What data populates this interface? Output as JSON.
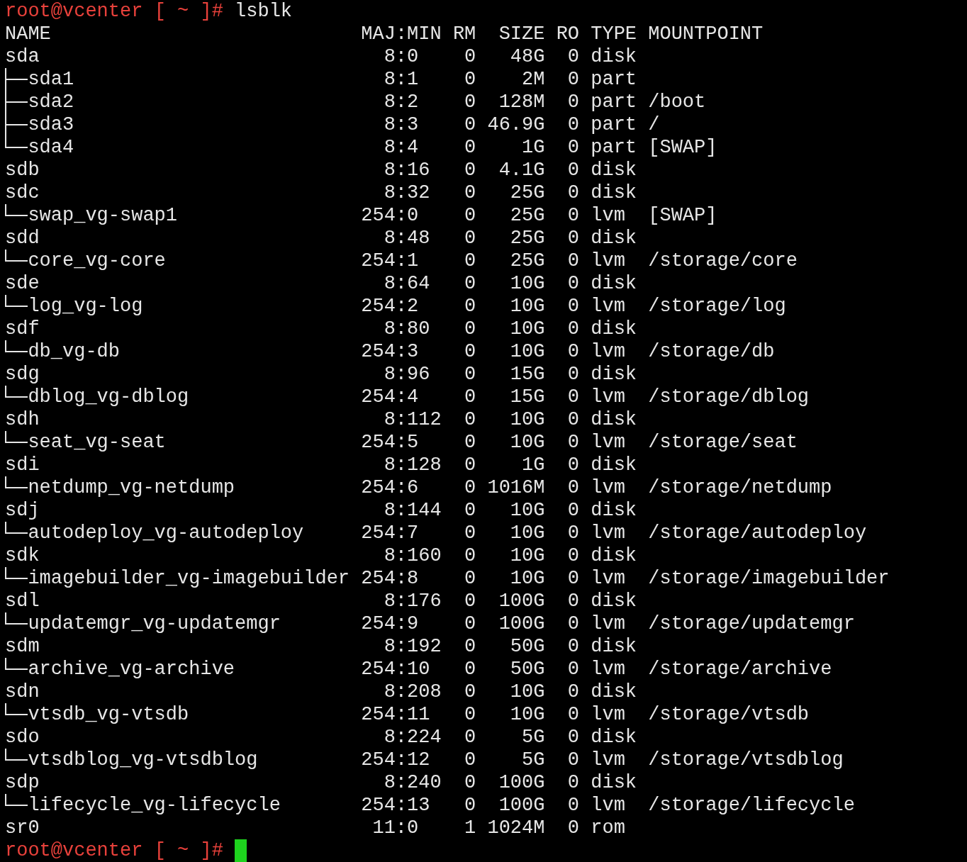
{
  "first_prompt": {
    "prompt": "root@vcenter [ ~ ]#",
    "command": "lsblk"
  },
  "columns": [
    "NAME",
    "MAJ:MIN",
    "RM",
    "SIZE",
    "RO",
    "TYPE",
    "MOUNTPOINT"
  ],
  "devices": [
    {
      "name": "sda",
      "maj_min": "8:0",
      "rm": "0",
      "size": "48G",
      "ro": "0",
      "type": "disk",
      "children": [
        {
          "name": "sda1",
          "maj_min": "8:1",
          "rm": "0",
          "size": "2M",
          "ro": "0",
          "type": "part"
        },
        {
          "name": "sda2",
          "maj_min": "8:2",
          "rm": "0",
          "size": "128M",
          "ro": "0",
          "type": "part",
          "mountpoint": "/boot"
        },
        {
          "name": "sda3",
          "maj_min": "8:3",
          "rm": "0",
          "size": "46.9G",
          "ro": "0",
          "type": "part",
          "mountpoint": "/"
        },
        {
          "name": "sda4",
          "maj_min": "8:4",
          "rm": "0",
          "size": "1G",
          "ro": "0",
          "type": "part",
          "mountpoint": "[SWAP]"
        }
      ]
    },
    {
      "name": "sdb",
      "maj_min": "8:16",
      "rm": "0",
      "size": "4.1G",
      "ro": "0",
      "type": "disk"
    },
    {
      "name": "sdc",
      "maj_min": "8:32",
      "rm": "0",
      "size": "25G",
      "ro": "0",
      "type": "disk",
      "children": [
        {
          "name": "swap_vg-swap1",
          "maj_min": "254:0",
          "rm": "0",
          "size": "25G",
          "ro": "0",
          "type": "lvm",
          "mountpoint": "[SWAP]"
        }
      ]
    },
    {
      "name": "sdd",
      "maj_min": "8:48",
      "rm": "0",
      "size": "25G",
      "ro": "0",
      "type": "disk",
      "children": [
        {
          "name": "core_vg-core",
          "maj_min": "254:1",
          "rm": "0",
          "size": "25G",
          "ro": "0",
          "type": "lvm",
          "mountpoint": "/storage/core"
        }
      ]
    },
    {
      "name": "sde",
      "maj_min": "8:64",
      "rm": "0",
      "size": "10G",
      "ro": "0",
      "type": "disk",
      "children": [
        {
          "name": "log_vg-log",
          "maj_min": "254:2",
          "rm": "0",
          "size": "10G",
          "ro": "0",
          "type": "lvm",
          "mountpoint": "/storage/log"
        }
      ]
    },
    {
      "name": "sdf",
      "maj_min": "8:80",
      "rm": "0",
      "size": "10G",
      "ro": "0",
      "type": "disk",
      "children": [
        {
          "name": "db_vg-db",
          "maj_min": "254:3",
          "rm": "0",
          "size": "10G",
          "ro": "0",
          "type": "lvm",
          "mountpoint": "/storage/db"
        }
      ]
    },
    {
      "name": "sdg",
      "maj_min": "8:96",
      "rm": "0",
      "size": "15G",
      "ro": "0",
      "type": "disk",
      "children": [
        {
          "name": "dblog_vg-dblog",
          "maj_min": "254:4",
          "rm": "0",
          "size": "15G",
          "ro": "0",
          "type": "lvm",
          "mountpoint": "/storage/dblog"
        }
      ]
    },
    {
      "name": "sdh",
      "maj_min": "8:112",
      "rm": "0",
      "size": "10G",
      "ro": "0",
      "type": "disk",
      "children": [
        {
          "name": "seat_vg-seat",
          "maj_min": "254:5",
          "rm": "0",
          "size": "10G",
          "ro": "0",
          "type": "lvm",
          "mountpoint": "/storage/seat"
        }
      ]
    },
    {
      "name": "sdi",
      "maj_min": "8:128",
      "rm": "0",
      "size": "1G",
      "ro": "0",
      "type": "disk",
      "children": [
        {
          "name": "netdump_vg-netdump",
          "maj_min": "254:6",
          "rm": "0",
          "size": "1016M",
          "ro": "0",
          "type": "lvm",
          "mountpoint": "/storage/netdump"
        }
      ]
    },
    {
      "name": "sdj",
      "maj_min": "8:144",
      "rm": "0",
      "size": "10G",
      "ro": "0",
      "type": "disk",
      "children": [
        {
          "name": "autodeploy_vg-autodeploy",
          "maj_min": "254:7",
          "rm": "0",
          "size": "10G",
          "ro": "0",
          "type": "lvm",
          "mountpoint": "/storage/autodeploy"
        }
      ]
    },
    {
      "name": "sdk",
      "maj_min": "8:160",
      "rm": "0",
      "size": "10G",
      "ro": "0",
      "type": "disk",
      "children": [
        {
          "name": "imagebuilder_vg-imagebuilder",
          "maj_min": "254:8",
          "rm": "0",
          "size": "10G",
          "ro": "0",
          "type": "lvm",
          "mountpoint": "/storage/imagebuilder"
        }
      ]
    },
    {
      "name": "sdl",
      "maj_min": "8:176",
      "rm": "0",
      "size": "100G",
      "ro": "0",
      "type": "disk",
      "children": [
        {
          "name": "updatemgr_vg-updatemgr",
          "maj_min": "254:9",
          "rm": "0",
          "size": "100G",
          "ro": "0",
          "type": "lvm",
          "mountpoint": "/storage/updatemgr"
        }
      ]
    },
    {
      "name": "sdm",
      "maj_min": "8:192",
      "rm": "0",
      "size": "50G",
      "ro": "0",
      "type": "disk",
      "children": [
        {
          "name": "archive_vg-archive",
          "maj_min": "254:10",
          "rm": "0",
          "size": "50G",
          "ro": "0",
          "type": "lvm",
          "mountpoint": "/storage/archive"
        }
      ]
    },
    {
      "name": "sdn",
      "maj_min": "8:208",
      "rm": "0",
      "size": "10G",
      "ro": "0",
      "type": "disk",
      "children": [
        {
          "name": "vtsdb_vg-vtsdb",
          "maj_min": "254:11",
          "rm": "0",
          "size": "10G",
          "ro": "0",
          "type": "lvm",
          "mountpoint": "/storage/vtsdb"
        }
      ]
    },
    {
      "name": "sdo",
      "maj_min": "8:224",
      "rm": "0",
      "size": "5G",
      "ro": "0",
      "type": "disk",
      "children": [
        {
          "name": "vtsdblog_vg-vtsdblog",
          "maj_min": "254:12",
          "rm": "0",
          "size": "5G",
          "ro": "0",
          "type": "lvm",
          "mountpoint": "/storage/vtsdblog"
        }
      ]
    },
    {
      "name": "sdp",
      "maj_min": "8:240",
      "rm": "0",
      "size": "100G",
      "ro": "0",
      "type": "disk",
      "children": [
        {
          "name": "lifecycle_vg-lifecycle",
          "maj_min": "254:13",
          "rm": "0",
          "size": "100G",
          "ro": "0",
          "type": "lvm",
          "mountpoint": "/storage/lifecycle"
        }
      ]
    },
    {
      "name": "sr0",
      "maj_min": "11:0",
      "rm": "1",
      "size": "1024M",
      "ro": "0",
      "type": "rom"
    }
  ],
  "last_prompt": {
    "prompt": "root@vcenter [ ~ ]#",
    "cursor": true
  }
}
